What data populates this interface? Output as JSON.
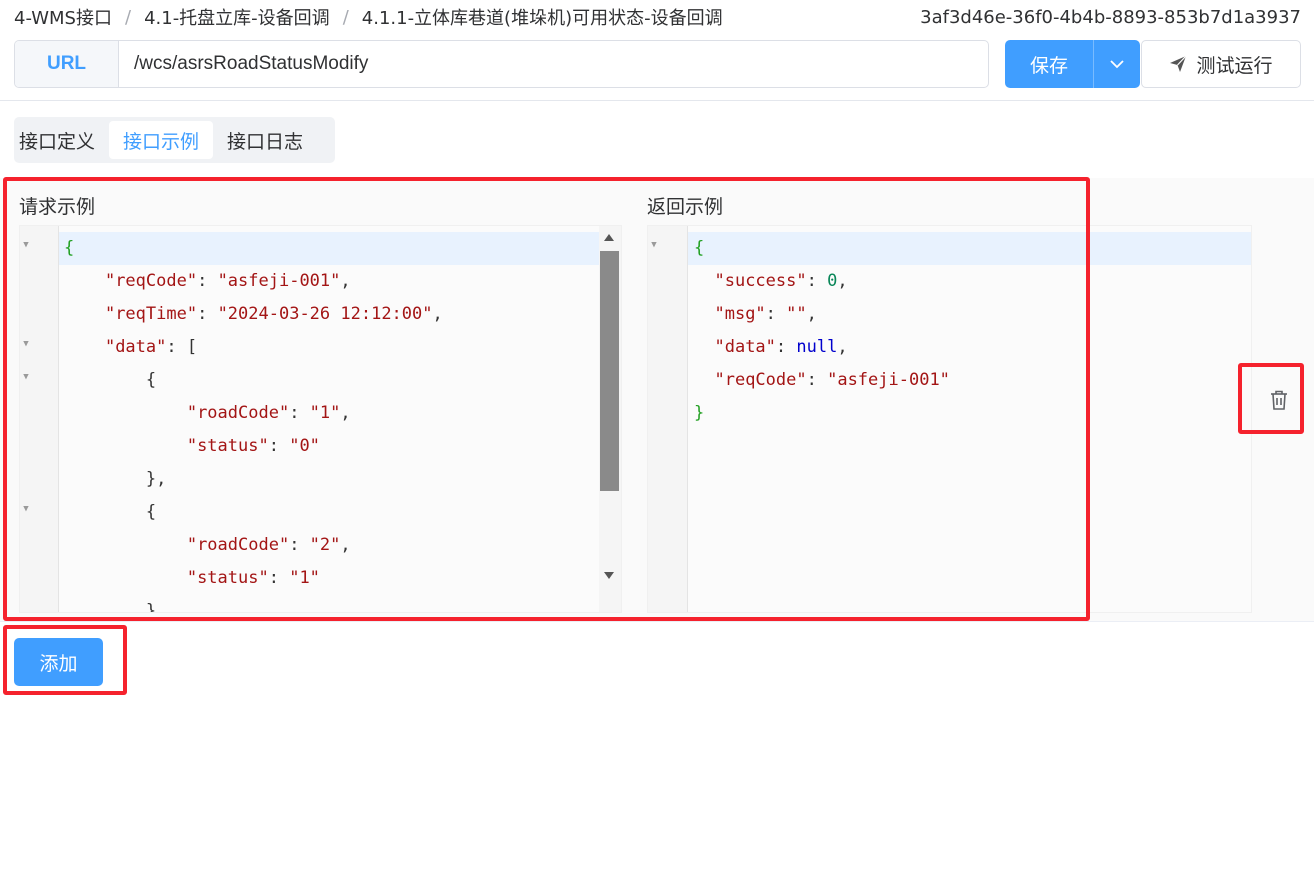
{
  "breadcrumb": {
    "items": [
      "4-WMS接口",
      "4.1-托盘立库-设备回调",
      "4.1.1-立体库巷道(堆垛机)可用状态-设备回调"
    ],
    "separator": "/"
  },
  "uuid": "3af3d46e-36f0-4b4b-8893-853b7d1a3937",
  "url": {
    "prefix_label": "URL",
    "value": "/wcs/asrsRoadStatusModify"
  },
  "toolbar": {
    "save_label": "保存",
    "test_label": "测试运行"
  },
  "tabs": [
    {
      "label": "接口定义",
      "active": false
    },
    {
      "label": "接口示例",
      "active": true
    },
    {
      "label": "接口日志",
      "active": false
    }
  ],
  "request_example": {
    "title": "请求示例",
    "lines": [
      "{",
      "    \"reqCode\": \"asfeji-001\",",
      "    \"reqTime\": \"2024-03-26 12:12:00\",",
      "    \"data\": [",
      "        {",
      "            \"roadCode\": \"1\",",
      "            \"status\": \"0\"",
      "        },",
      "        {",
      "            \"roadCode\": \"2\",",
      "            \"status\": \"1\"",
      "        }"
    ]
  },
  "response_example": {
    "title": "返回示例",
    "lines": [
      "{",
      "  \"success\": 0,",
      "  \"msg\": \"\",",
      "  \"data\": null,",
      "  \"reqCode\": \"asfeji-001\"",
      "}"
    ]
  },
  "add_label": "添加",
  "colors": {
    "primary": "#409eff",
    "highlight": "#f5222d",
    "json_key": "#a31515",
    "json_number": "#098658",
    "json_null": "#0000cd",
    "json_brace": "#22a022"
  },
  "icons": {
    "dropdown": "chevron-down-icon",
    "test": "send-icon",
    "delete": "trash-icon",
    "fold": "fold-triangle-icon"
  }
}
